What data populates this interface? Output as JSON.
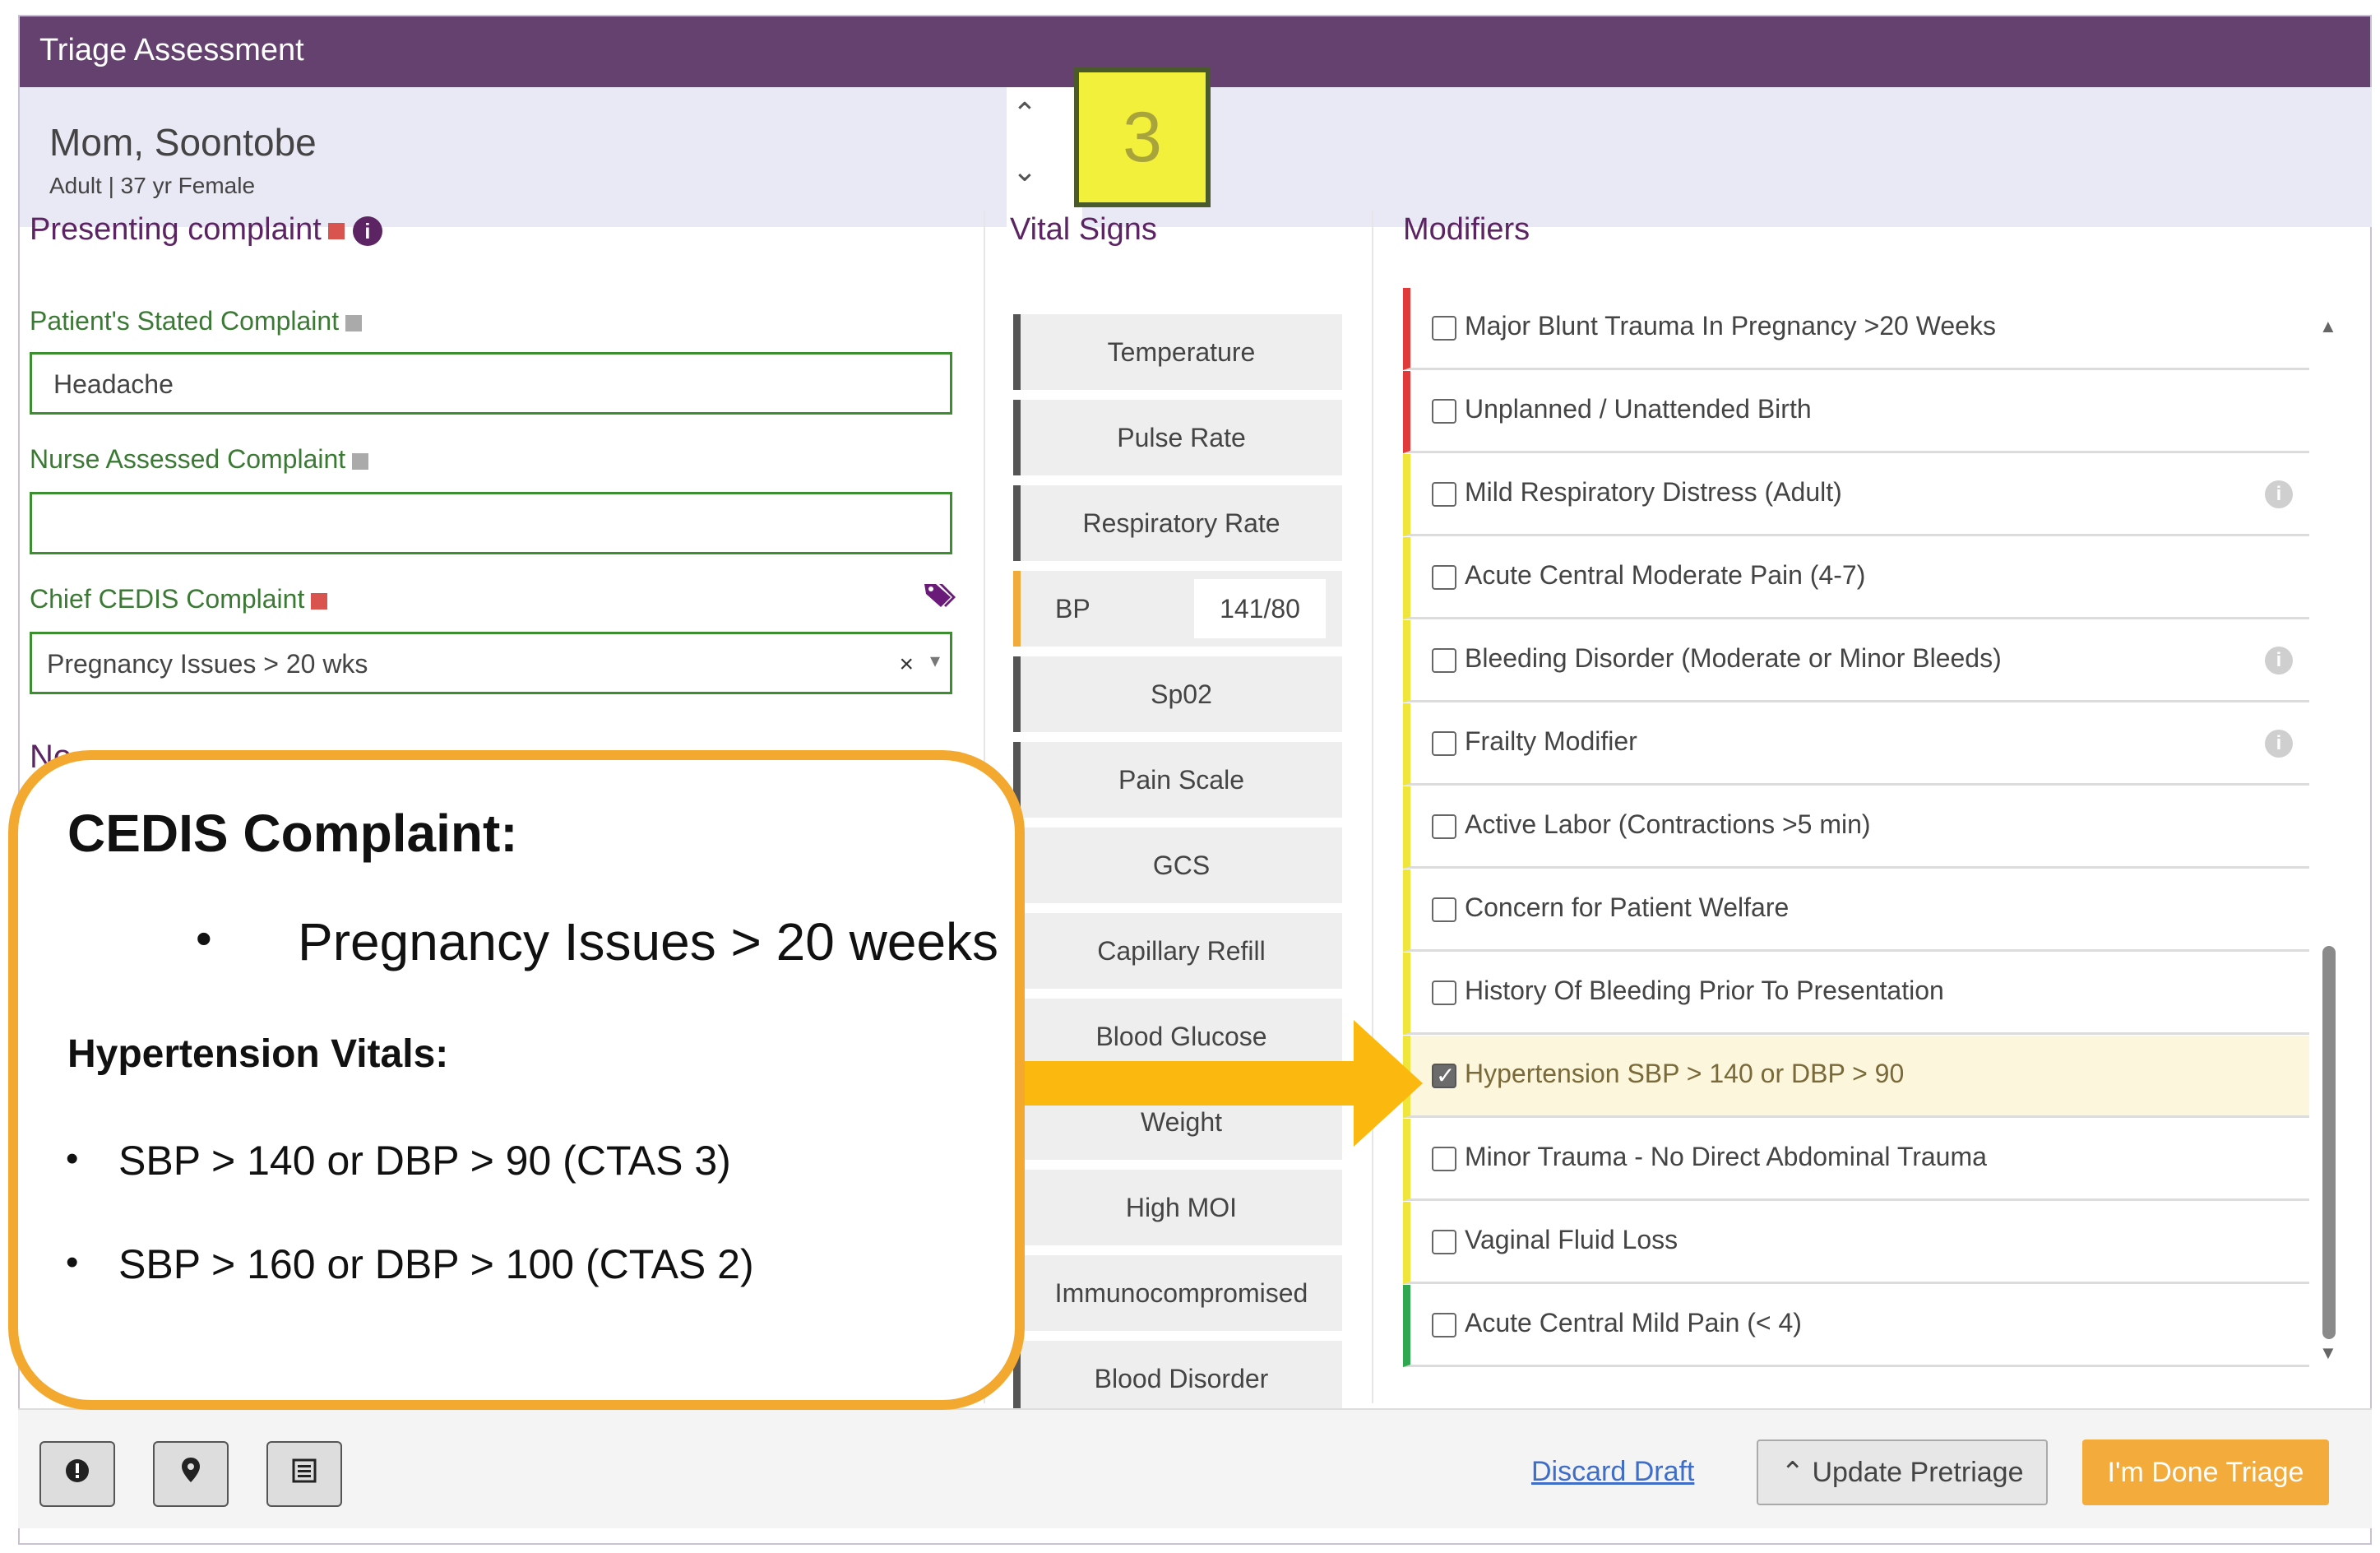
{
  "window": {
    "title": "Triage Assessment"
  },
  "patient": {
    "name": "Mom, Soontobe",
    "meta": "Adult | 37 yr Female"
  },
  "ctas_level": "3",
  "presenting_complaint": {
    "heading": "Presenting complaint",
    "stated_label": "Patient's Stated Complaint",
    "stated_value": "Headache",
    "nurse_label": "Nurse Assessed Complaint",
    "nurse_value": "",
    "cedis_label": "Chief CEDIS Complaint",
    "cedis_value": "Pregnancy Issues > 20 wks",
    "cedis_clear": "×",
    "notes_partial": "No"
  },
  "vital_signs": {
    "heading": "Vital Signs",
    "items": [
      {
        "label": "Temperature"
      },
      {
        "label": "Pulse Rate"
      },
      {
        "label": "Respiratory Rate"
      },
      {
        "label": "BP",
        "value": "141/80"
      },
      {
        "label": "Sp02"
      },
      {
        "label": "Pain Scale"
      },
      {
        "label": "GCS"
      },
      {
        "label": "Capillary Refill"
      },
      {
        "label": "Blood Glucose"
      },
      {
        "label": "Weight"
      },
      {
        "label": "High MOI"
      },
      {
        "label": "Immunocompromised"
      },
      {
        "label": "Blood Disorder"
      }
    ]
  },
  "modifiers": {
    "heading": "Modifiers",
    "items": [
      {
        "label": "Major Blunt Trauma In Pregnancy >20 Weeks",
        "level": "red",
        "checked": false,
        "info": false
      },
      {
        "label": "Unplanned / Unattended Birth",
        "level": "red",
        "checked": false,
        "info": false
      },
      {
        "label": "Mild Respiratory Distress (Adult)",
        "level": "yellow",
        "checked": false,
        "info": true
      },
      {
        "label": "Acute Central Moderate Pain (4-7)",
        "level": "yellow",
        "checked": false,
        "info": false
      },
      {
        "label": "Bleeding Disorder (Moderate or Minor Bleeds)",
        "level": "yellow",
        "checked": false,
        "info": true
      },
      {
        "label": "Frailty Modifier",
        "level": "yellow",
        "checked": false,
        "info": true
      },
      {
        "label": "Active Labor (Contractions >5 min)",
        "level": "yellow",
        "checked": false,
        "info": false
      },
      {
        "label": "Concern for Patient Welfare",
        "level": "yellow",
        "checked": false,
        "info": false
      },
      {
        "label": "History Of Bleeding Prior To Presentation",
        "level": "yellow",
        "checked": false,
        "info": false
      },
      {
        "label": "Hypertension SBP > 140 or DBP > 90",
        "level": "yellow",
        "checked": true,
        "info": false
      },
      {
        "label": "Minor Trauma - No Direct Abdominal Trauma",
        "level": "yellow",
        "checked": false,
        "info": false
      },
      {
        "label": "Vaginal Fluid Loss",
        "level": "yellow",
        "checked": false,
        "info": false
      },
      {
        "label": "Acute Central Mild Pain (< 4)",
        "level": "green",
        "checked": false,
        "info": false
      }
    ]
  },
  "footer": {
    "discard_label": "Discard Draft",
    "update_label": "Update Pretriage",
    "done_label": "I'm Done Triage"
  },
  "callout": {
    "title": "CEDIS Complaint:",
    "complaint_item": "Pregnancy Issues > 20 weeks",
    "vitals_title": "Hypertension Vitals:",
    "vitals_items": [
      "SBP > 140 or DBP > 90 (CTAS 3)",
      "SBP > 160 or DBP > 100 (CTAS 2)"
    ]
  },
  "colors": {
    "title_bar": "#654170",
    "accent_purple": "#5c2463",
    "field_green": "#3c8f2e",
    "ctas_yellow": "#f3f03b",
    "callout_orange": "#f3a92f",
    "done_button": "#f3ac3c",
    "level_red": "#e03a3a",
    "level_yellow": "#f0e53a",
    "level_green": "#2fa84f"
  },
  "icons": {
    "info": "info-circle-icon",
    "tag": "tags-icon",
    "alert": "exclamation-circle-icon",
    "location": "map-marker-icon",
    "list": "list-icon"
  }
}
